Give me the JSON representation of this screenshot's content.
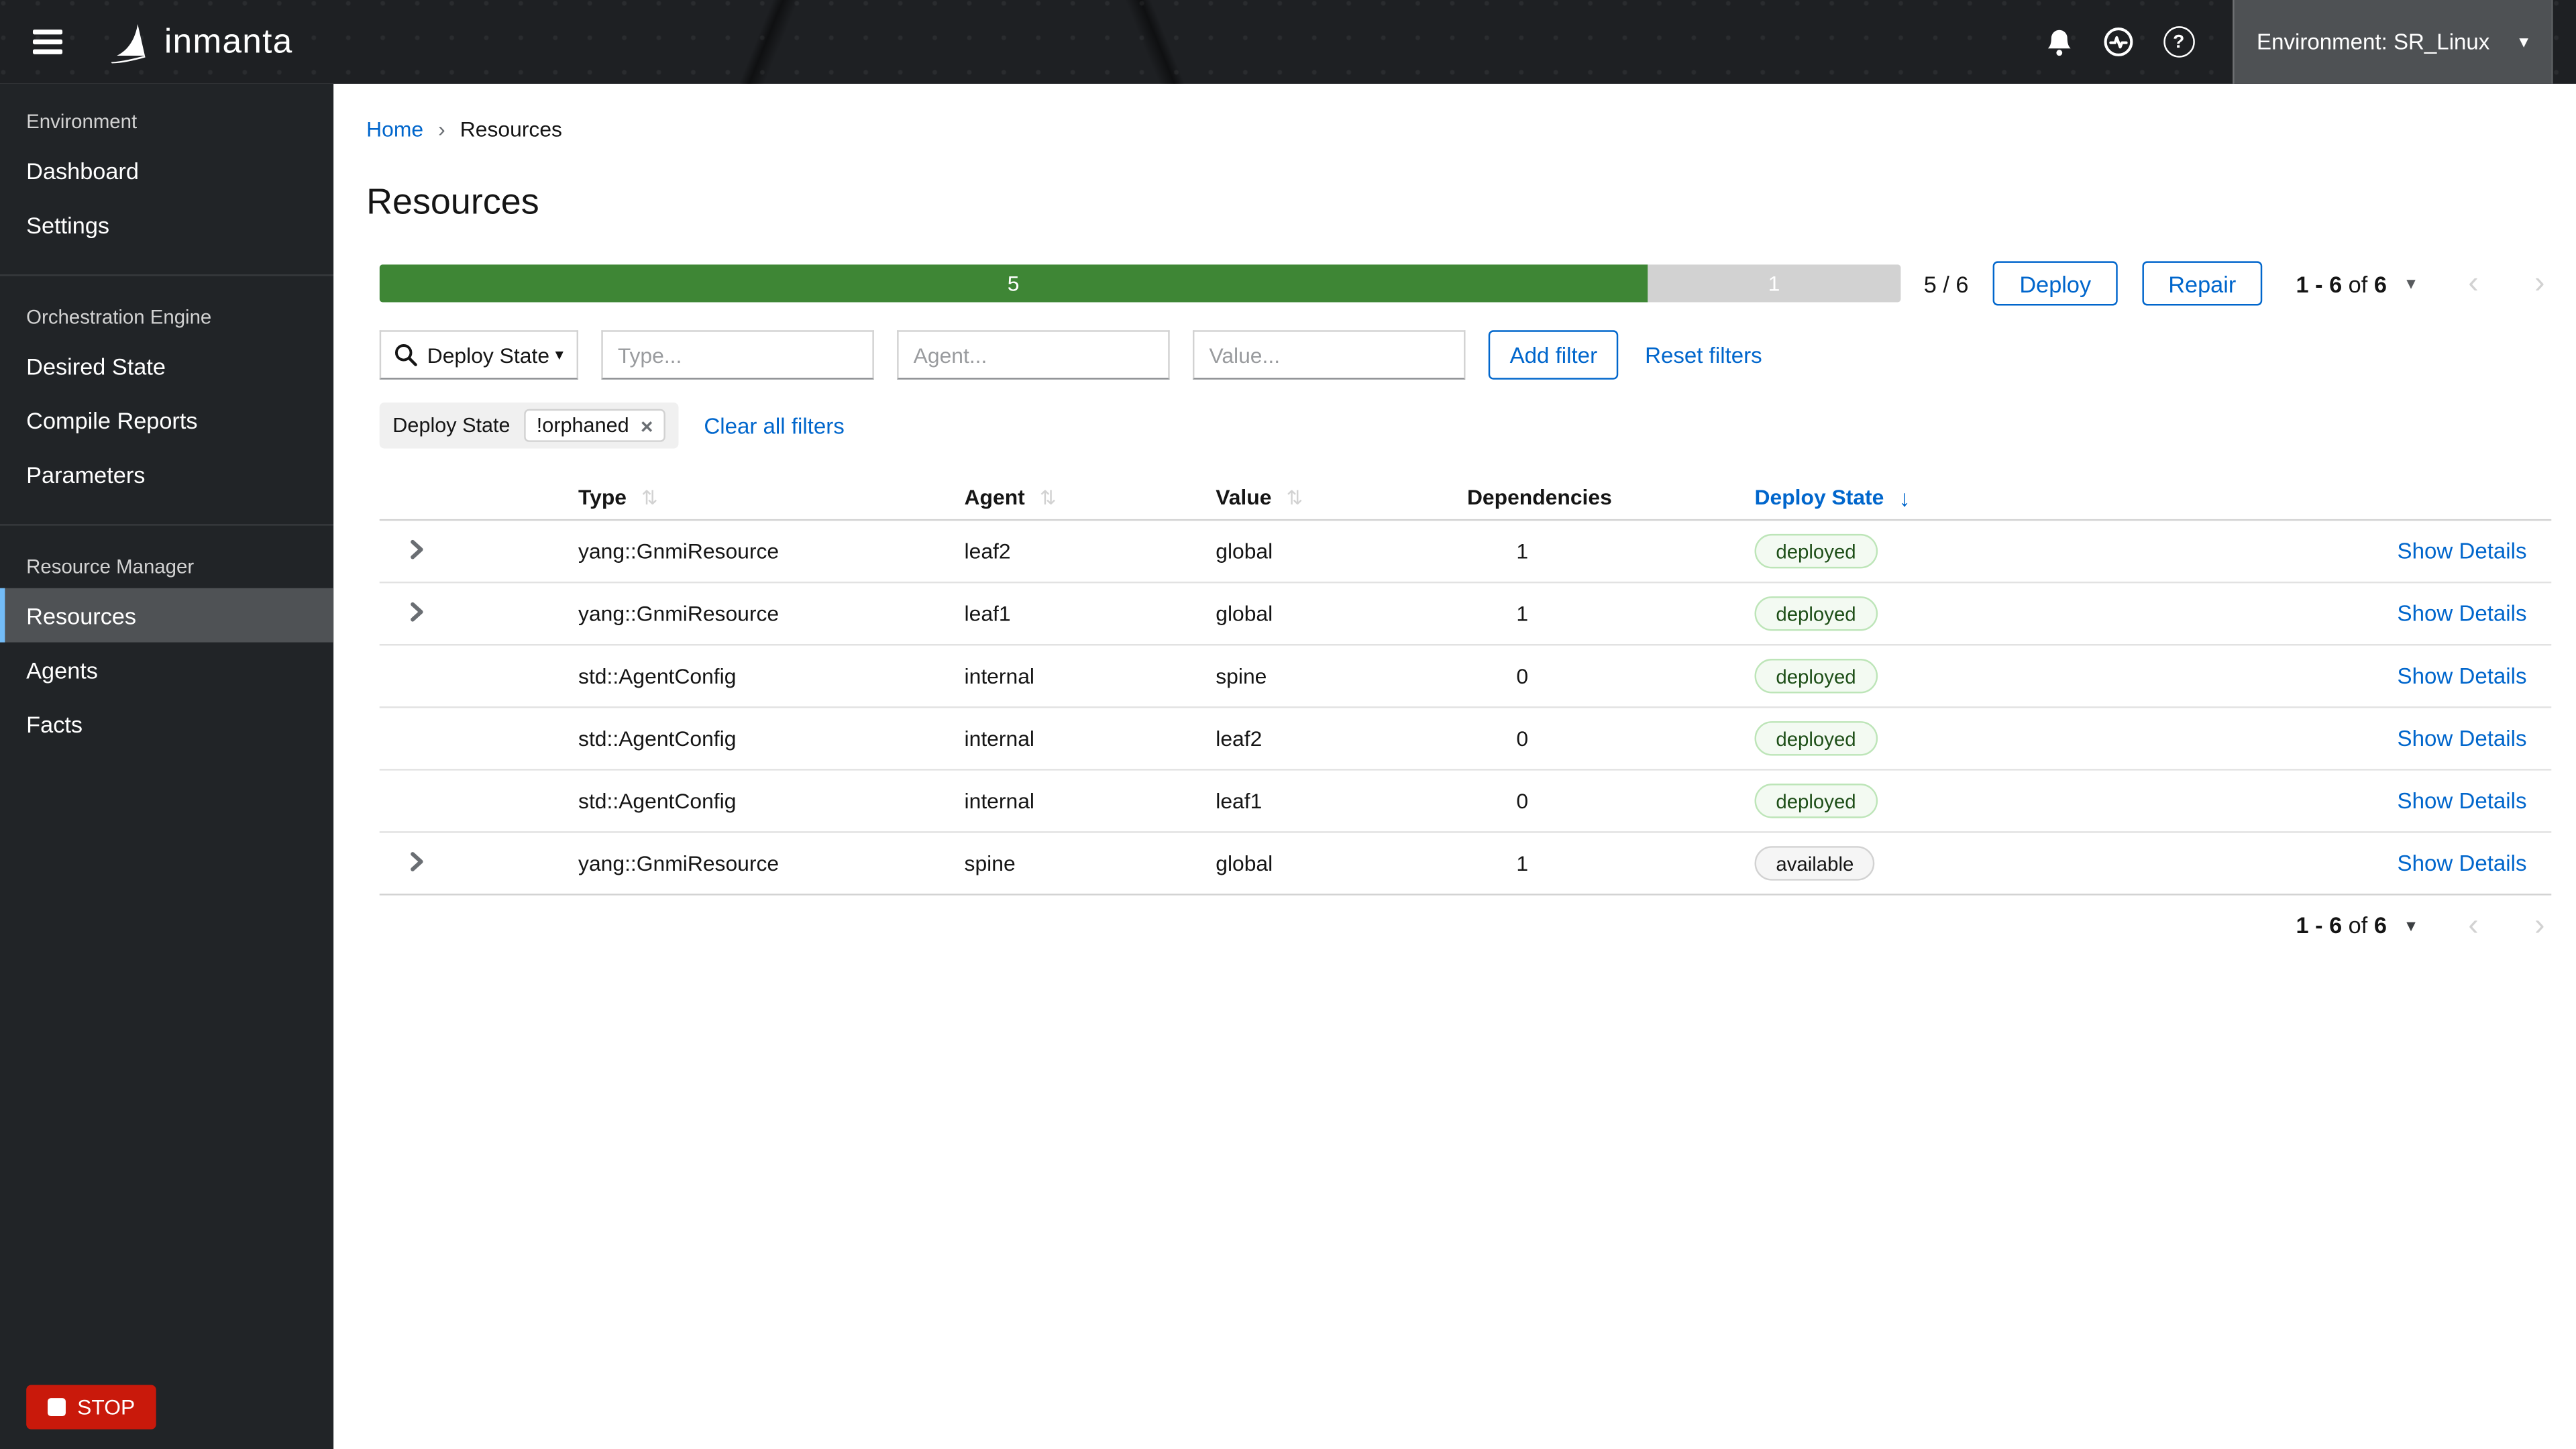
{
  "navbar": {
    "brand": "inmanta",
    "environment_label": "Environment: SR_Linux"
  },
  "sidebar": {
    "groups": [
      {
        "label": "Environment",
        "items": [
          {
            "label": "Dashboard"
          },
          {
            "label": "Settings"
          }
        ]
      },
      {
        "label": "Orchestration Engine",
        "items": [
          {
            "label": "Desired State"
          },
          {
            "label": "Compile Reports"
          },
          {
            "label": "Parameters"
          }
        ]
      },
      {
        "label": "Resource Manager",
        "items": [
          {
            "label": "Resources"
          },
          {
            "label": "Agents"
          },
          {
            "label": "Facts"
          }
        ]
      }
    ],
    "active_item": "Resources",
    "stop_label": "STOP"
  },
  "breadcrumb": {
    "home": "Home",
    "current": "Resources"
  },
  "page": {
    "title": "Resources"
  },
  "summary": {
    "progress": {
      "deployed": 5,
      "total": 6,
      "green_label": "5",
      "gray_label": "1",
      "ratio_text": "5 / 6"
    },
    "deploy_button": "Deploy",
    "repair_button": "Repair"
  },
  "pagination": {
    "bold_range": "1 - 6",
    "of_word": "of",
    "bold_total": "6"
  },
  "filters": {
    "state_select_label": "Deploy State...",
    "type_placeholder": "Type...",
    "agent_placeholder": "Agent...",
    "value_placeholder": "Value...",
    "add_filter": "Add filter",
    "reset_filters": "Reset filters",
    "chip_group_label": "Deploy State",
    "chip_value": "!orphaned",
    "clear_all": "Clear all filters"
  },
  "table": {
    "headers": {
      "type": "Type",
      "agent": "Agent",
      "value": "Value",
      "dependencies": "Dependencies",
      "deploy_state": "Deploy State"
    },
    "sorted_by": "Deploy State",
    "sort_direction": "descending",
    "show_details_label": "Show Details",
    "rows": [
      {
        "expandable": true,
        "type": "yang::GnmiResource",
        "agent": "leaf2",
        "value": "global",
        "dependencies": "1",
        "deploy_state": "deployed",
        "state_color": "green"
      },
      {
        "expandable": true,
        "type": "yang::GnmiResource",
        "agent": "leaf1",
        "value": "global",
        "dependencies": "1",
        "deploy_state": "deployed",
        "state_color": "green"
      },
      {
        "expandable": false,
        "type": "std::AgentConfig",
        "agent": "internal",
        "value": "spine",
        "dependencies": "0",
        "deploy_state": "deployed",
        "state_color": "green"
      },
      {
        "expandable": false,
        "type": "std::AgentConfig",
        "agent": "internal",
        "value": "leaf2",
        "dependencies": "0",
        "deploy_state": "deployed",
        "state_color": "green"
      },
      {
        "expandable": false,
        "type": "std::AgentConfig",
        "agent": "internal",
        "value": "leaf1",
        "dependencies": "0",
        "deploy_state": "deployed",
        "state_color": "green"
      },
      {
        "expandable": true,
        "type": "yang::GnmiResource",
        "agent": "spine",
        "value": "global",
        "dependencies": "1",
        "deploy_state": "available",
        "state_color": "grey"
      }
    ]
  },
  "icons": {
    "caret_down": "▾",
    "help_glyph": "?",
    "sort_inactive": "⇅",
    "sort_desc": "↓",
    "breadcrumb_sep": "›",
    "pager_prev": "‹",
    "pager_next": "›",
    "chip_close": "×"
  },
  "colors": {
    "accent_blue": "#0066cc",
    "progress_green": "#3e8635",
    "badge_green_bg": "#f3faf2",
    "badge_green_border": "#bde5b8",
    "badge_green_text": "#1e4f18",
    "badge_grey_bg": "#f5f5f5",
    "danger_red": "#c9190b",
    "sidebar_active_accent": "#73bcf7"
  }
}
